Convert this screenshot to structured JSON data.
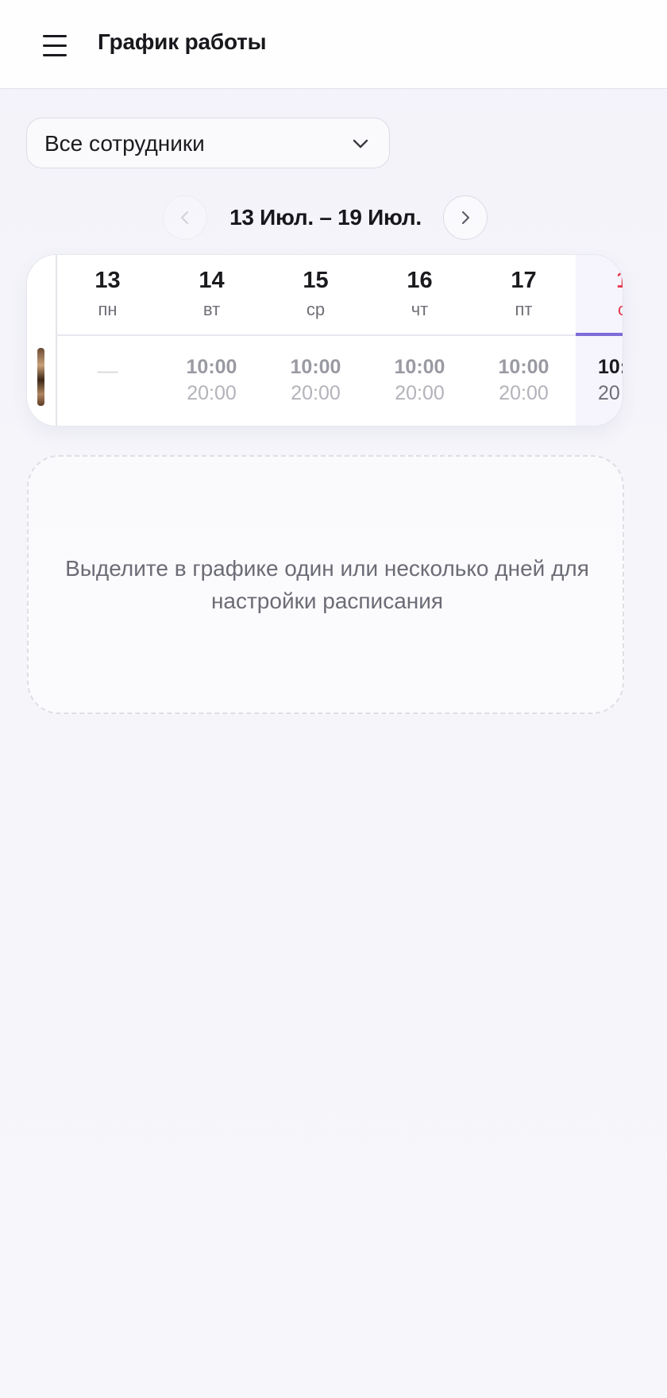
{
  "header": {
    "title": "График работы",
    "menu_icon": "hamburger-menu-icon"
  },
  "filter": {
    "selected": "Все сотрудники",
    "icon": "chevron-down-icon"
  },
  "week_nav": {
    "range_label": "13 Июл. – 19 Июл.",
    "prev_icon": "chevron-left-icon",
    "next_icon": "chevron-right-icon"
  },
  "schedule": {
    "days": [
      {
        "num": "13",
        "name": "пн",
        "start": "",
        "end": "",
        "off": "—"
      },
      {
        "num": "14",
        "name": "вт",
        "start": "10:00",
        "end": "20:00",
        "off": ""
      },
      {
        "num": "15",
        "name": "ср",
        "start": "10:00",
        "end": "20:00",
        "off": ""
      },
      {
        "num": "16",
        "name": "чт",
        "start": "10:00",
        "end": "20:00",
        "off": ""
      },
      {
        "num": "17",
        "name": "пт",
        "start": "10:00",
        "end": "20:00",
        "off": ""
      },
      {
        "num": "1",
        "name": "с",
        "start": "10:",
        "end": "20",
        "off": ""
      }
    ],
    "colors": {
      "weekend": "#e53a4d",
      "accent": "#7c6cd8"
    }
  },
  "hint": {
    "text": "Выделите в графике один или несколько дней для настройки расписания"
  }
}
